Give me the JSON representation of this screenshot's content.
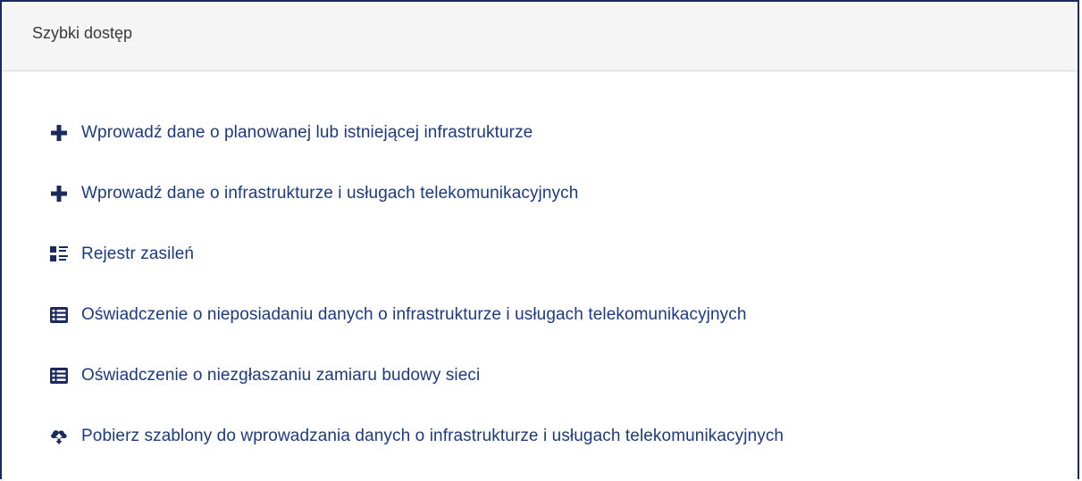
{
  "panel": {
    "title": "Szybki dostęp"
  },
  "links": [
    {
      "label": "Wprowadź dane o planowanej lub istniejącej infrastrukturze",
      "icon": "plus-icon"
    },
    {
      "label": "Wprowadź dane o infrastrukturze i usługach telekomunikacyjnych",
      "icon": "plus-icon"
    },
    {
      "label": "Rejestr zasileń",
      "icon": "list-details-icon"
    },
    {
      "label": "Oświadczenie o nieposiadaniu danych o infrastrukturze i usługach telekomunikacyjnych",
      "icon": "table-list-icon"
    },
    {
      "label": "Oświadczenie o niezgłaszaniu zamiaru budowy sieci",
      "icon": "table-list-icon"
    },
    {
      "label": "Pobierz szablony do wprowadzania danych o infrastrukturze i usługach telekomunikacyjnych",
      "icon": "cloud-download-icon"
    }
  ],
  "colors": {
    "link": "#1b3a80",
    "icon": "#1b2a5c",
    "border": "#1b2a5c",
    "header_bg": "#f5f5f5"
  }
}
